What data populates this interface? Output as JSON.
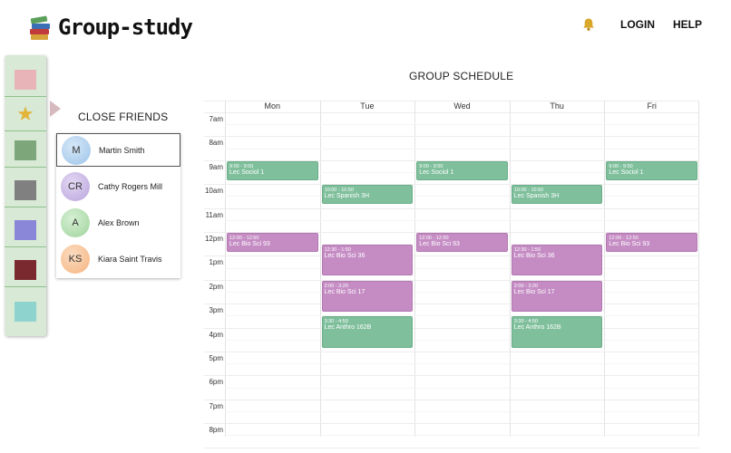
{
  "app": {
    "name": "Group-study"
  },
  "nav": {
    "login": "LOGIN",
    "help": "HELP"
  },
  "colors": {
    "sidebar_bg": "#d8ead6",
    "class_green": "#7fbf9c",
    "class_purple": "#c58cc4"
  },
  "sidebar": {
    "items": [
      {
        "name": "pink-group",
        "color": "#e8b4b8"
      },
      {
        "name": "favorites-star-icon",
        "color": "#e2b43a"
      },
      {
        "name": "green-group",
        "color": "#7da77a"
      },
      {
        "name": "gray-group",
        "color": "#808080"
      },
      {
        "name": "purple-group",
        "color": "#8a86d8"
      },
      {
        "name": "maroon-group",
        "color": "#7a2a2e"
      },
      {
        "name": "teal-group",
        "color": "#8fd3cf"
      }
    ]
  },
  "friends": {
    "title": "CLOSE FRIENDS",
    "list": [
      {
        "initials": "M",
        "name": "Martin Smith",
        "color": "#9cc3e8",
        "selected": true
      },
      {
        "initials": "CR",
        "name": "Cathy Rogers Mill",
        "color": "#b9a3dc",
        "selected": false
      },
      {
        "initials": "A",
        "name": "Alex Brown",
        "color": "#9fd39b",
        "selected": false
      },
      {
        "initials": "KS",
        "name": "Kiara Saint Travis",
        "color": "#f5b37e",
        "selected": false
      }
    ]
  },
  "schedule": {
    "title": "GROUP SCHEDULE",
    "days": [
      "Mon",
      "Tue",
      "Wed",
      "Thu",
      "Fri"
    ],
    "times": [
      "7am",
      "8am",
      "9am",
      "10am",
      "11am",
      "12pm",
      "1pm",
      "2pm",
      "3pm",
      "4pm",
      "5pm",
      "6pm",
      "7pm",
      "8pm"
    ],
    "events": [
      {
        "day": 0,
        "start": 9.0,
        "end": 9.83,
        "time": "9:00 - 9:50",
        "title": "Lec Sociol 1",
        "color": "green"
      },
      {
        "day": 2,
        "start": 9.0,
        "end": 9.83,
        "time": "9:00 - 9:50",
        "title": "Lec Sociol 1",
        "color": "green"
      },
      {
        "day": 4,
        "start": 9.0,
        "end": 9.83,
        "time": "9:00 - 9:50",
        "title": "Lec Sociol 1",
        "color": "green"
      },
      {
        "day": 1,
        "start": 10.0,
        "end": 10.83,
        "time": "10:00 - 10:50",
        "title": "Lec Spanish 3H",
        "color": "green"
      },
      {
        "day": 3,
        "start": 10.0,
        "end": 10.83,
        "time": "10:00 - 10:50",
        "title": "Lec Spanish 3H",
        "color": "green"
      },
      {
        "day": 0,
        "start": 12.0,
        "end": 12.83,
        "time": "12:00 - 12:50",
        "title": "Lec Bio Sci 93",
        "color": "purple"
      },
      {
        "day": 2,
        "start": 12.0,
        "end": 12.83,
        "time": "12:00 - 12:50",
        "title": "Lec Bio Sci 93",
        "color": "purple"
      },
      {
        "day": 4,
        "start": 12.0,
        "end": 12.83,
        "time": "12:00 - 12:50",
        "title": "Lec Bio Sci 93",
        "color": "purple"
      },
      {
        "day": 1,
        "start": 12.5,
        "end": 13.83,
        "time": "12:30 - 1:50",
        "title": "Lec Bio Sci 36",
        "color": "purple"
      },
      {
        "day": 3,
        "start": 12.5,
        "end": 13.83,
        "time": "12:30 - 1:50",
        "title": "Lec Bio Sci 36",
        "color": "purple"
      },
      {
        "day": 1,
        "start": 14.0,
        "end": 15.33,
        "time": "2:00 - 3:20",
        "title": "Lec Bio Sci 17",
        "color": "purple"
      },
      {
        "day": 3,
        "start": 14.0,
        "end": 15.33,
        "time": "2:00 - 3:20",
        "title": "Lec Bio Sci 17",
        "color": "purple"
      },
      {
        "day": 1,
        "start": 15.5,
        "end": 16.83,
        "time": "3:30 - 4:50",
        "title": "Lec Anthro 162B",
        "color": "green"
      },
      {
        "day": 3,
        "start": 15.5,
        "end": 16.83,
        "time": "3:30 - 4:50",
        "title": "Lec Anthro 162B",
        "color": "green"
      }
    ]
  }
}
